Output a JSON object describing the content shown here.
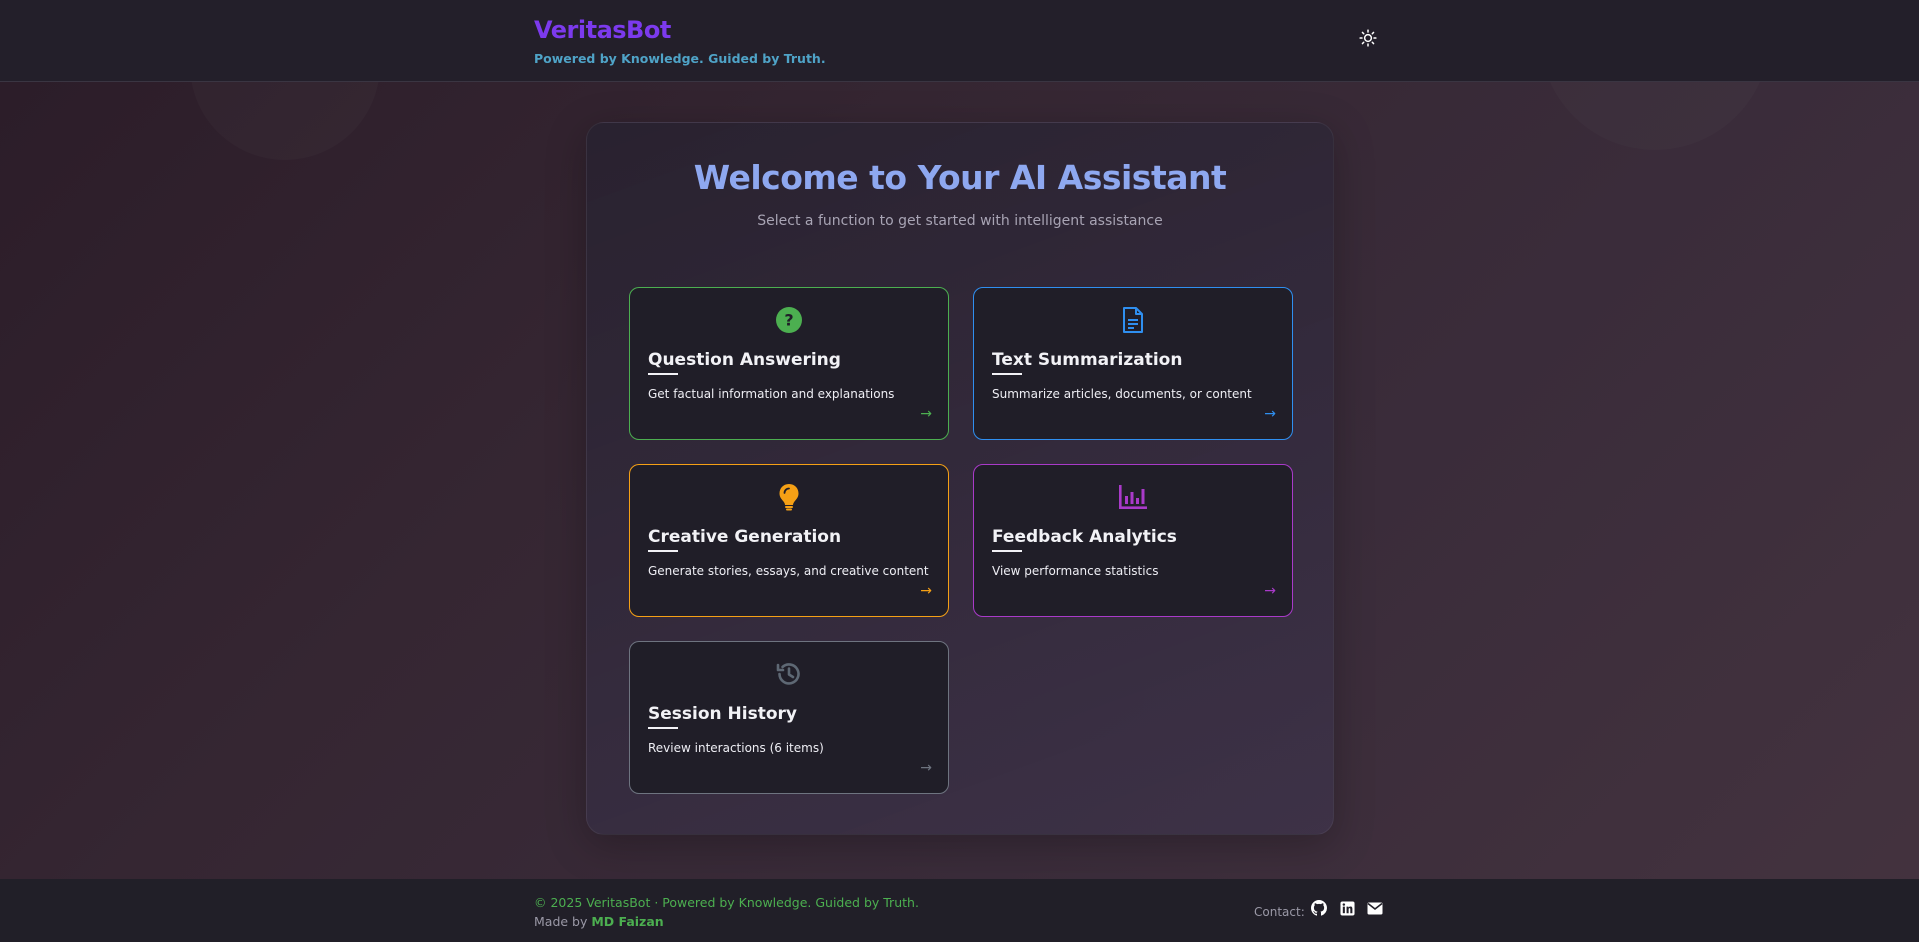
{
  "header": {
    "title": "VeritasBot",
    "tagline": "Powered by Knowledge. Guided by Truth.",
    "theme_toggle_icon": "sun-icon"
  },
  "main": {
    "title": "Welcome to Your AI Assistant",
    "subtitle": "Select a function to get started with intelligent assistance",
    "cards": [
      {
        "title": "Question Answering",
        "description": "Get factual information and explanations",
        "icon": "question-circle-icon",
        "color": "#4caf50",
        "arrow": "→"
      },
      {
        "title": "Text Summarization",
        "description": "Summarize articles, documents, or content",
        "icon": "document-icon",
        "color": "#2f8ff0",
        "arrow": "→"
      },
      {
        "title": "Creative Generation",
        "description": "Generate stories, essays, and creative content",
        "icon": "lightbulb-icon",
        "color": "#f5a015",
        "arrow": "→"
      },
      {
        "title": "Feedback Analytics",
        "description": "View performance statistics",
        "icon": "analytics-chart-icon",
        "color": "#a93ac9",
        "arrow": "→"
      },
      {
        "title": "Session History",
        "description": "Review interactions (6 items)",
        "icon": "history-icon",
        "color": "#6e7480",
        "arrow": "→"
      }
    ]
  },
  "footer": {
    "copyright": "© 2025 VeritasBot · Powered by Knowledge. Guided by Truth.",
    "made_by_prefix": "Made by ",
    "author": "MD Faizan",
    "contact_label": "Contact:",
    "contact_icons": [
      "github-icon",
      "linkedin-icon",
      "email-icon"
    ]
  }
}
